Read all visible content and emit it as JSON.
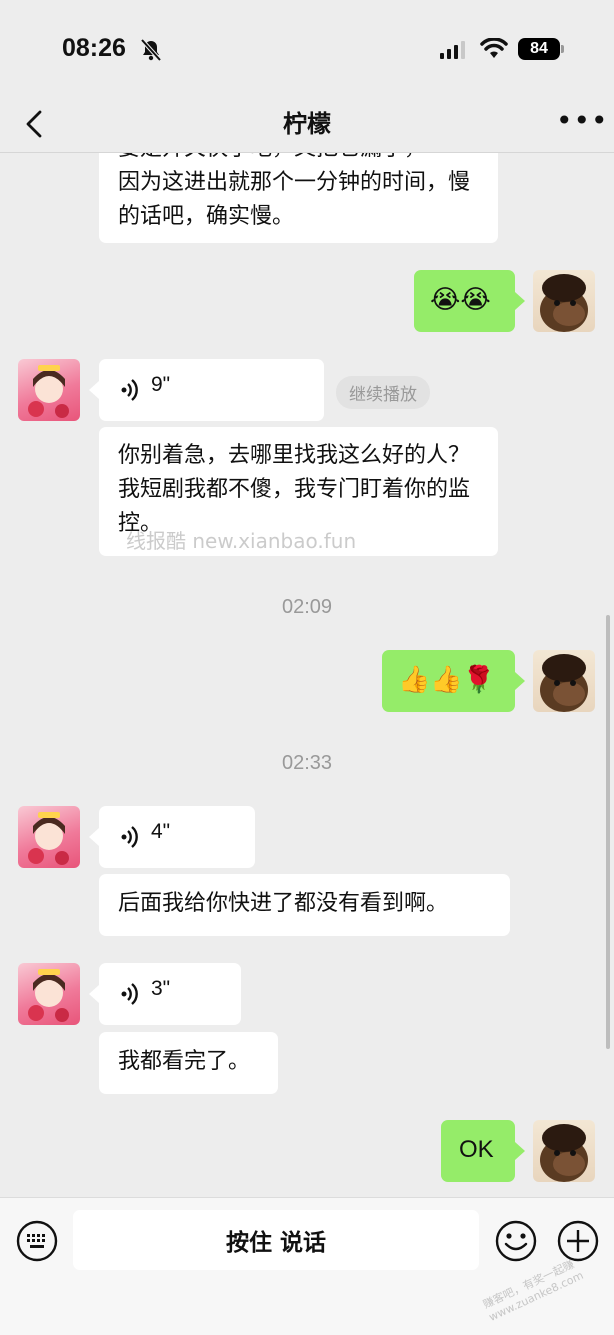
{
  "status": {
    "time": "08:26",
    "battery": "84"
  },
  "header": {
    "title": "柠檬"
  },
  "messages": {
    "m1": "因为这进出就那个一分钟的时间，慢的话吧，确实慢。",
    "m1_partial": "要是开关快了吧，又把它漏了，",
    "m2_emoji": "😭😭",
    "v1": "9\"",
    "continue_label": "继续播放",
    "m3": "你别着急，去哪里找我这么好的人？我短剧我都不傻，我专门盯着你的监控。",
    "ts1": "02:09",
    "m4_emoji": "👍👍🌹",
    "ts2": "02:33",
    "v2": "4\"",
    "m5": "后面我给你快进了都没有看到啊。",
    "v3": "3\"",
    "m6": "我都看完了。",
    "m7": "OK"
  },
  "watermark": "线报酷 new.xianbao.fun",
  "corner_watermark": "赚客吧，有奖一起赚 www.zuanke8.com",
  "input": {
    "hold_label": "按住 说话"
  },
  "colors": {
    "self_bubble": "#95ec69",
    "other_bubble": "#ffffff",
    "background": "#ededed"
  }
}
